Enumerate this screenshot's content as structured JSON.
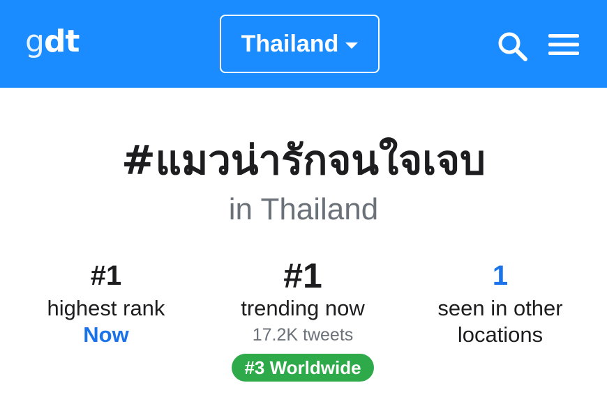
{
  "header": {
    "logo_g": "g",
    "logo_dt": "dt",
    "country_selector": "Thailand",
    "icons": [
      "search-icon",
      "menu-icon",
      "caret-down-icon"
    ],
    "bg_color": "#1a8cff"
  },
  "trend": {
    "hashtag": "#แมวน่ารักจนใจเจบ",
    "location": "in Thailand"
  },
  "stats": {
    "highest_rank": {
      "value": "#1",
      "label": "highest rank",
      "when": "Now"
    },
    "trending_now": {
      "value": "#1",
      "label": "trending now",
      "tweets": "17.2K tweets",
      "worldwide_badge": "#3 Worldwide"
    },
    "other_locations": {
      "value": "1",
      "label_line1": "seen in other",
      "label_line2": "locations"
    }
  },
  "colors": {
    "accent": "#1a73e8",
    "badge": "#2eaa4a"
  }
}
